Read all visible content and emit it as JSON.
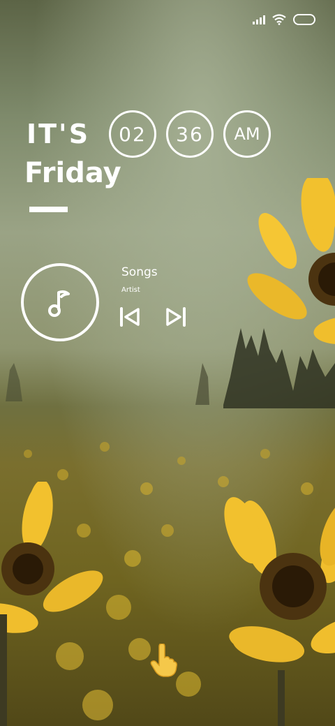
{
  "lockscreen": {
    "greeting_top": "IT'S",
    "greeting_day": "Friday",
    "time": {
      "hour": "02",
      "minute": "36",
      "meridiem": "AM"
    }
  },
  "music": {
    "title": "Songs",
    "artist": "Artist"
  },
  "icons": {
    "status": [
      "signal-icon",
      "wifi-icon",
      "battery-icon"
    ],
    "player": [
      "music-note-icon",
      "previous-icon",
      "next-icon"
    ],
    "hint": "pointer-hand-icon"
  },
  "colors": {
    "text": "#ffffff",
    "petal": "#f2c12e",
    "hand": "#f5c84a"
  }
}
